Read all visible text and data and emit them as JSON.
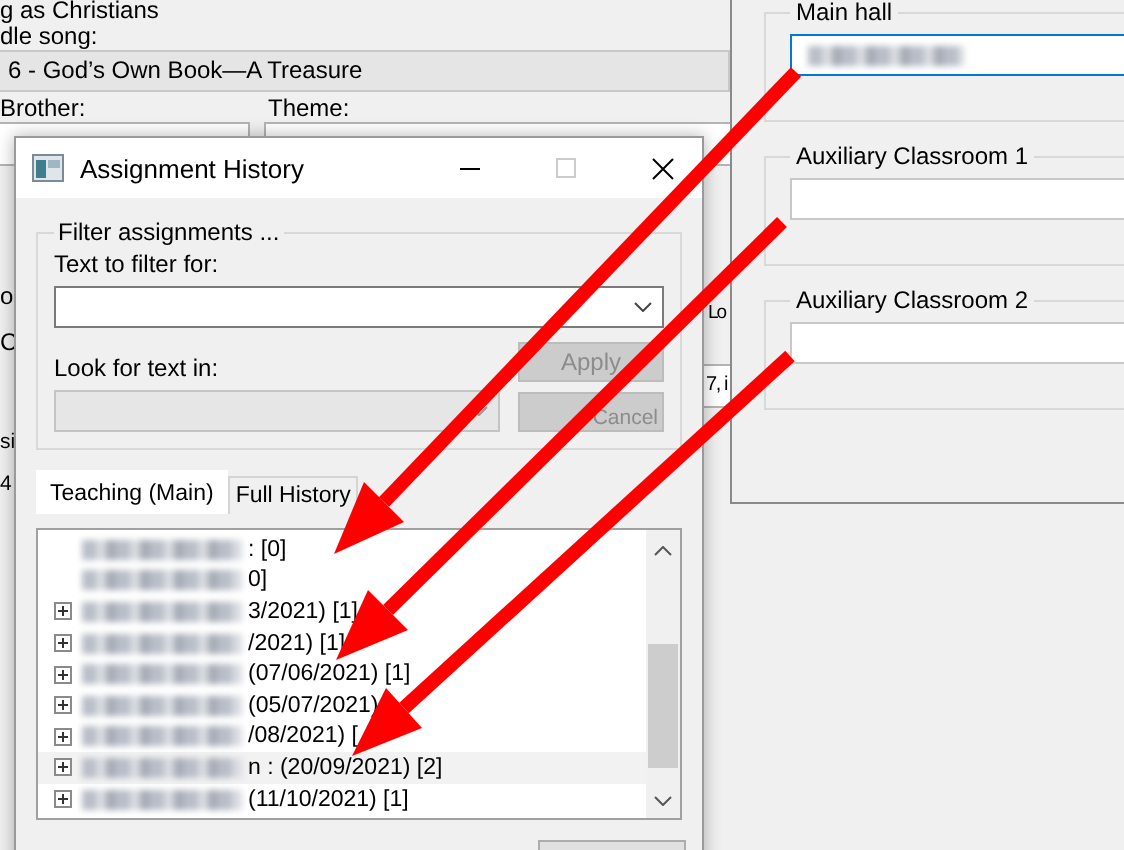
{
  "background_form": {
    "caption_top": "g as Christians",
    "song_label": "dle song:",
    "song_value": "6 - God’s Own Book—A Treasure",
    "brother_label": "Brother:",
    "theme_label": "Theme:",
    "fragments": [
      "o",
      "C",
      "si",
      "4",
      "Lo",
      "7, i"
    ]
  },
  "rooms_window": {
    "groups": [
      {
        "title": "Main hall",
        "focused": true,
        "redacted": true
      },
      {
        "title": "Auxiliary Classroom 1",
        "focused": false,
        "redacted": false
      },
      {
        "title": "Auxiliary Classroom 2",
        "focused": false,
        "redacted": false
      }
    ]
  },
  "dialog": {
    "title": "Assignment History",
    "filter_group": "Filter assignments ...",
    "text_label": "Text to filter for:",
    "look_label": "Look for text in:",
    "buttons": [
      {
        "label": "Apply",
        "disabled": true
      },
      {
        "label": "Cancel",
        "disabled": true
      }
    ],
    "tabs": [
      {
        "label": "Teaching (Main)",
        "selected": true
      },
      {
        "label": "Full History",
        "selected": false
      }
    ],
    "rows": [
      {
        "text": ": [0]",
        "expandable": false,
        "selected": false,
        "redacted": true
      },
      {
        "text": "0]",
        "expandable": false,
        "selected": false,
        "redacted": true
      },
      {
        "text": "3/2021) [1]",
        "expandable": true,
        "selected": false,
        "redacted": true
      },
      {
        "text": "/2021) [1]",
        "expandable": true,
        "selected": false,
        "redacted": true
      },
      {
        "text": "(07/06/2021) [1]",
        "expandable": true,
        "selected": false,
        "redacted": true
      },
      {
        "text": "(05/07/2021)",
        "expandable": true,
        "selected": false,
        "redacted": true
      },
      {
        "text": "/08/2021) [",
        "expandable": true,
        "selected": false,
        "redacted": true
      },
      {
        "text": "n : (20/09/2021) [2]",
        "expandable": true,
        "selected": true,
        "redacted": true
      },
      {
        "text": "(11/10/2021) [1]",
        "expandable": true,
        "selected": false,
        "redacted": true
      }
    ]
  }
}
